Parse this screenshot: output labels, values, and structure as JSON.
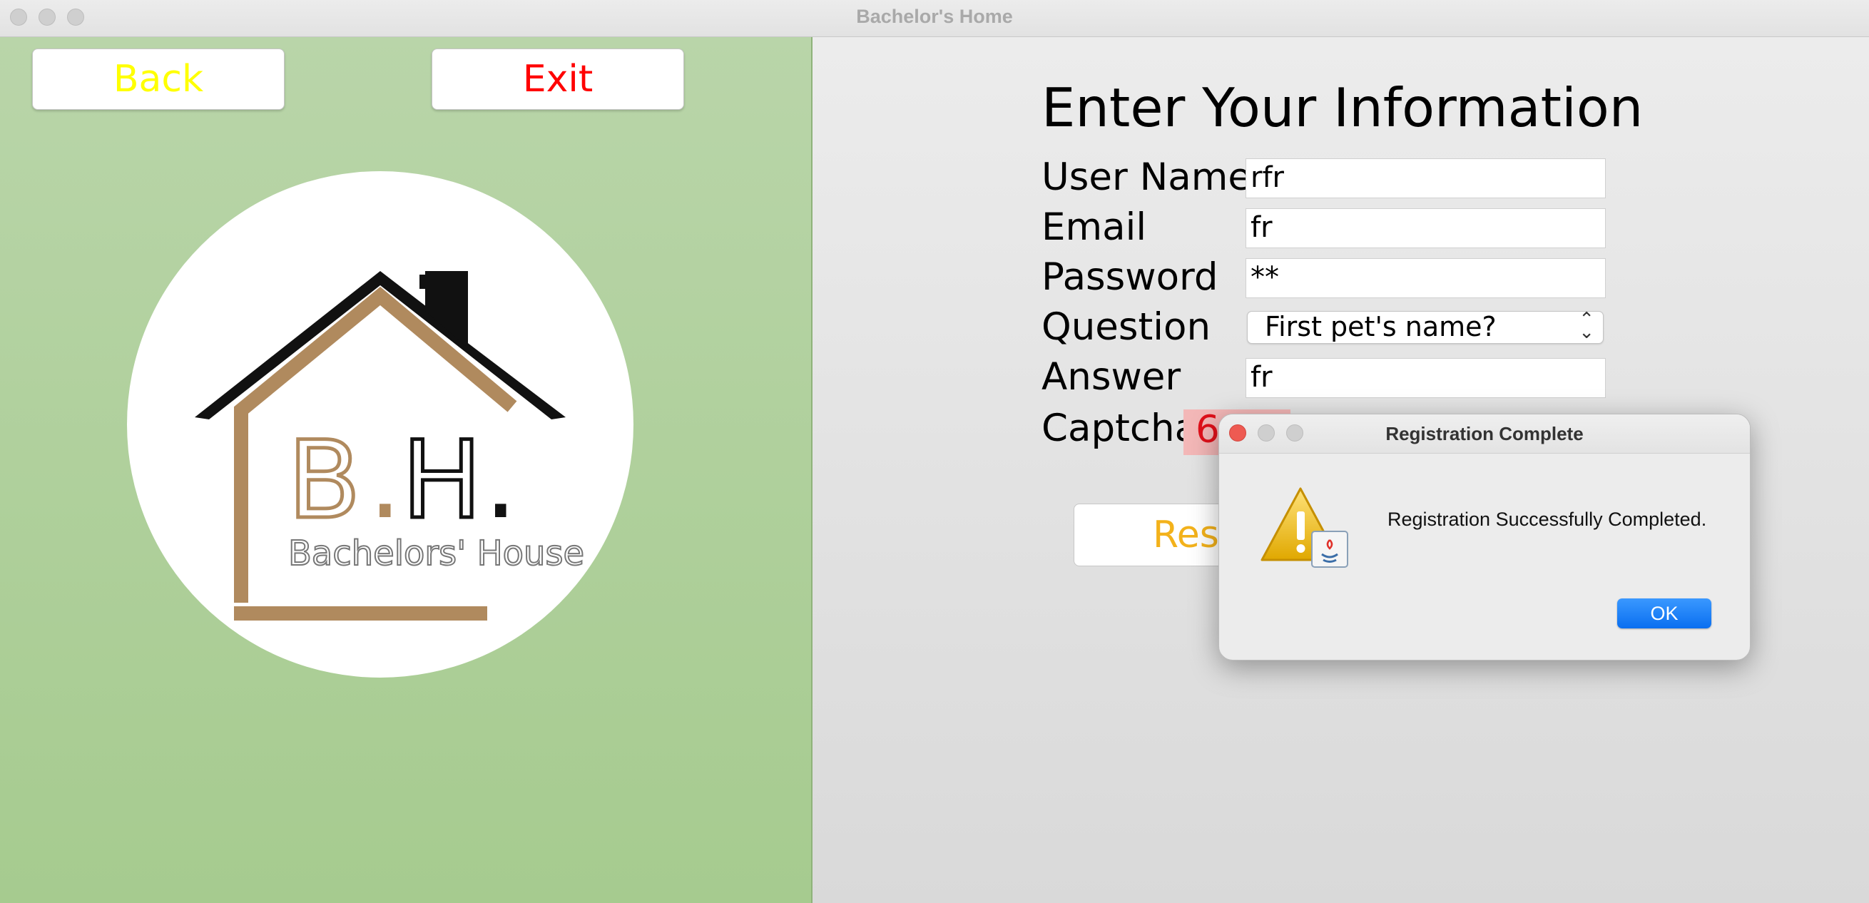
{
  "window": {
    "title": "Bachelor's Home"
  },
  "left_panel": {
    "back_label": "Back",
    "exit_label": "Exit",
    "logo": {
      "initials_b": "B",
      "initials_dot1": ".",
      "initials_h": "H",
      "initials_dot2": ".",
      "tagline": "Bachelors' House"
    },
    "colors": {
      "back": "#ffff00",
      "exit": "#ff0000"
    }
  },
  "form": {
    "title": "Enter Your Information",
    "fields": [
      {
        "label": "User Name",
        "value": "rfr"
      },
      {
        "label": "Email",
        "value": "fr"
      },
      {
        "label": "Password",
        "value": "**"
      },
      {
        "label": "Question",
        "value": "First pet's name?"
      },
      {
        "label": "Answer",
        "value": "fr"
      }
    ],
    "captcha_label": "Captcha",
    "captcha_partial": "6",
    "reset_partial_label": "Res"
  },
  "dialog": {
    "title": "Registration Complete",
    "message": "Registration Successfully Completed.",
    "ok_label": "OK",
    "icon": "warning-java-icon"
  }
}
